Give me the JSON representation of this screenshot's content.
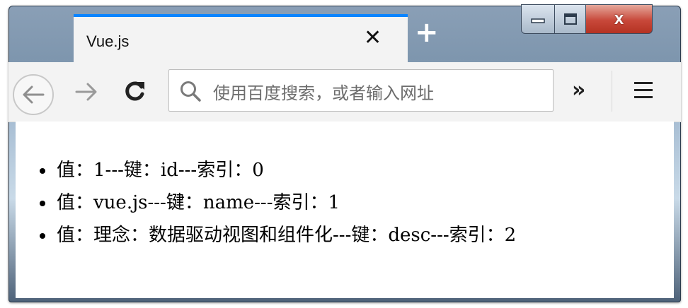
{
  "tab": {
    "title": "Vue.js",
    "close_glyph": "✕"
  },
  "new_tab": {
    "glyph": "+"
  },
  "window_controls": {
    "close_glyph": "x"
  },
  "urlbar": {
    "placeholder": "使用百度搜索，或者输入网址"
  },
  "toolbar": {
    "overflow_glyph": "»"
  },
  "list": [
    {
      "text": "值：1---键：id---索引：0"
    },
    {
      "text": "值：vue.js---键：name---索引：1"
    },
    {
      "text": "值：理念：数据驱动视图和组件化---键：desc---索引：2"
    }
  ],
  "colors": {
    "tab_accent": "#0a84ff",
    "close_button": "#c8483a"
  }
}
